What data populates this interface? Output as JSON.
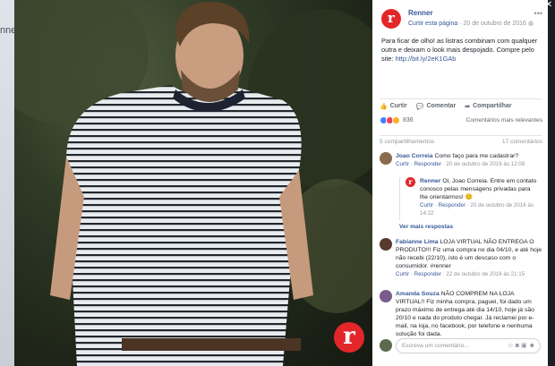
{
  "background": {
    "partial_text": "nne"
  },
  "photo": {
    "logo_letter": "r"
  },
  "post": {
    "page_name": "Renner",
    "like_page": "Curtir esta página",
    "date": "20 de outubro de 2016",
    "text": "Para ficar de olho! as listras combinam com qualquer outra e deixam o look mais despojado. Compre pelo site: ",
    "link": "http://bit.ly/2eK1GAb",
    "actions": {
      "like": "Curtir",
      "comment": "Comentar",
      "share": "Compartilhar"
    },
    "reactions_count": "836",
    "relevant": "Comentários mais relevantes",
    "shares": "5 compartilhamentos",
    "comments_count": "17 comentários"
  },
  "comments": [
    {
      "name": "Joao Correia",
      "text": "Como faço para me cadastrar?",
      "meta_actions": "Curtir · Responder",
      "meta_date": "20 de outubro de 2016 às 12:08"
    },
    {
      "name": "Fabianne Lima",
      "text": "LOJA VIRTUAL NÃO ENTREGA O PRODUTO!!! Fiz uma compra no dia 04/10, e até hoje não recebi (22/10), isto é um descaso com o consumidor. #renner",
      "meta_actions": "Curtir · Responder",
      "meta_date": "22 de outubro de 2016 às 21:15"
    },
    {
      "name": "Amanda Souza",
      "text": "NÃO COMPREM NA LOJA VIRTUAL!! Fiz minha compra, paguei, foi dado um prazo máximo de entrega até dia 14/10, hoje já são 20/10 e nada do produto chegar. Já reclamei por e-mail, na loja, no facebook, por telefone e nenhuma solução foi dada."
    }
  ],
  "reply": {
    "name": "Renner",
    "text": "Oi, Joao Correia. Entre em contato conosco pelas mensagens privadas para lhe orientarmos! 😊",
    "meta_actions": "Curtir · Responder",
    "meta_date": "20 de outubro de 2016 às 14:22",
    "more_replies": "Ver mais respostas"
  },
  "compose": {
    "placeholder": "Escreva um comentário..."
  }
}
